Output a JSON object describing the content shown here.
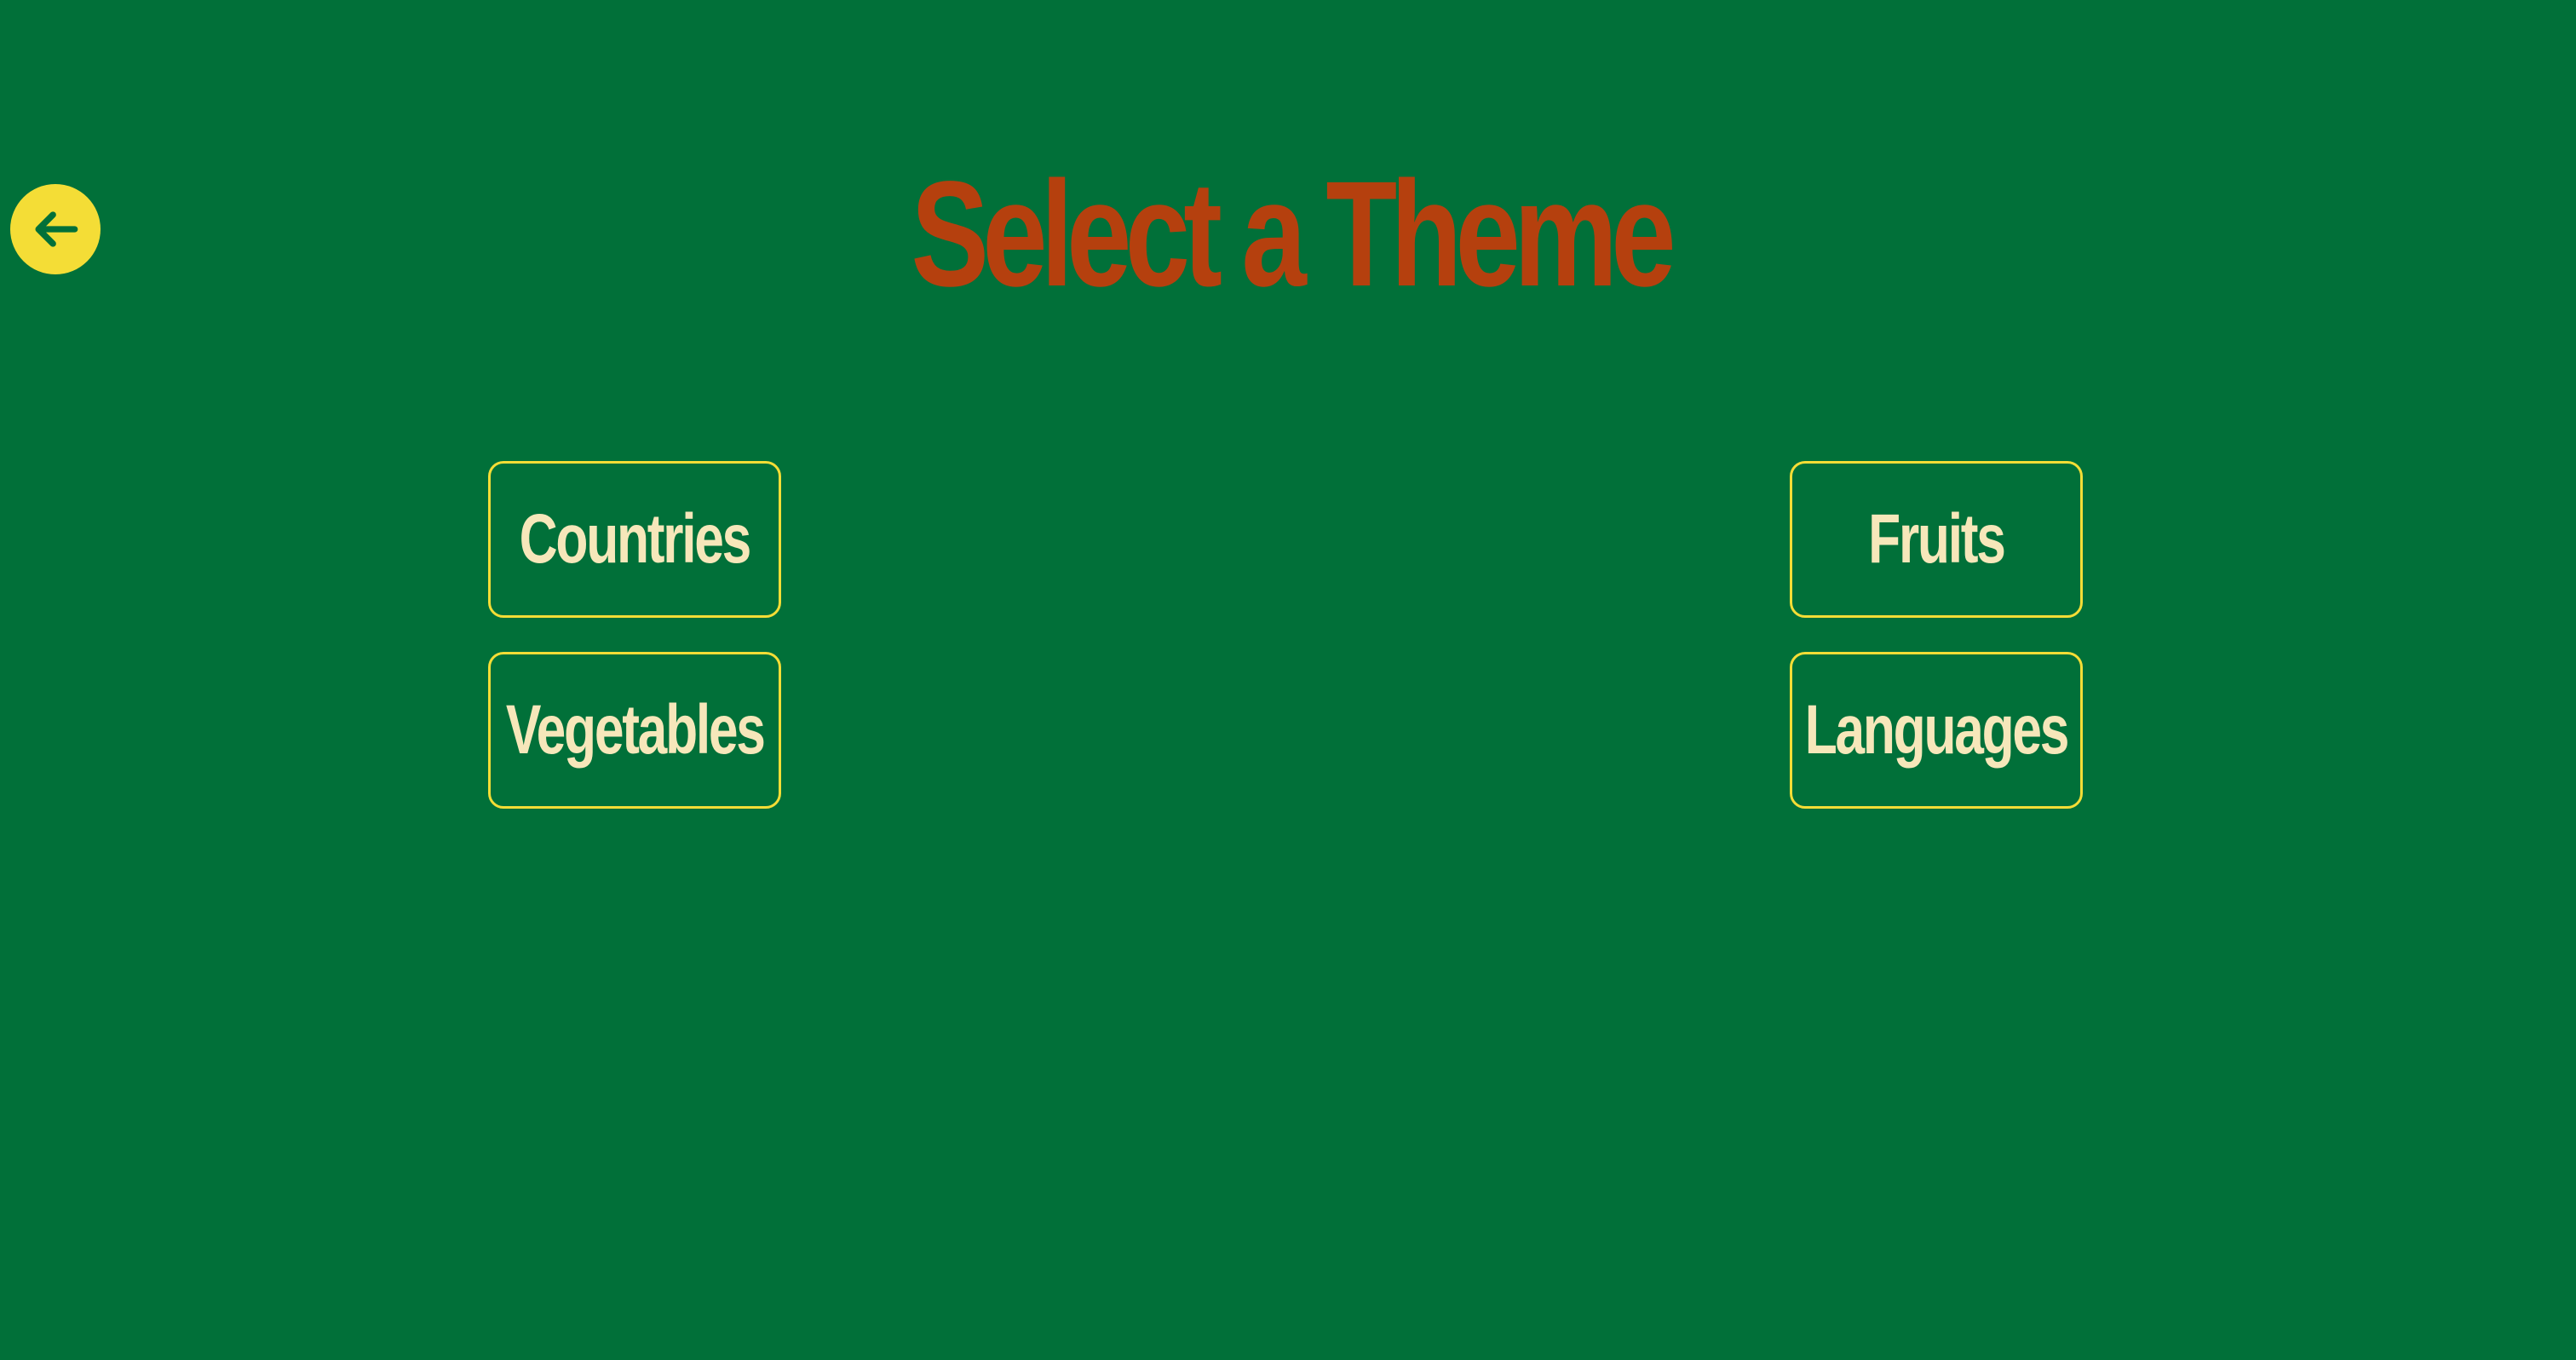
{
  "header": {
    "back_icon": "arrow-left-icon",
    "title": "Select a Theme"
  },
  "themes": [
    {
      "label": "Countries"
    },
    {
      "label": "Fruits"
    },
    {
      "label": "Vegetables"
    },
    {
      "label": "Languages"
    }
  ],
  "colors": {
    "background": "#017039",
    "title": "#B5400E",
    "accent": "#F4DD36",
    "button_text": "#F6E7BA"
  }
}
